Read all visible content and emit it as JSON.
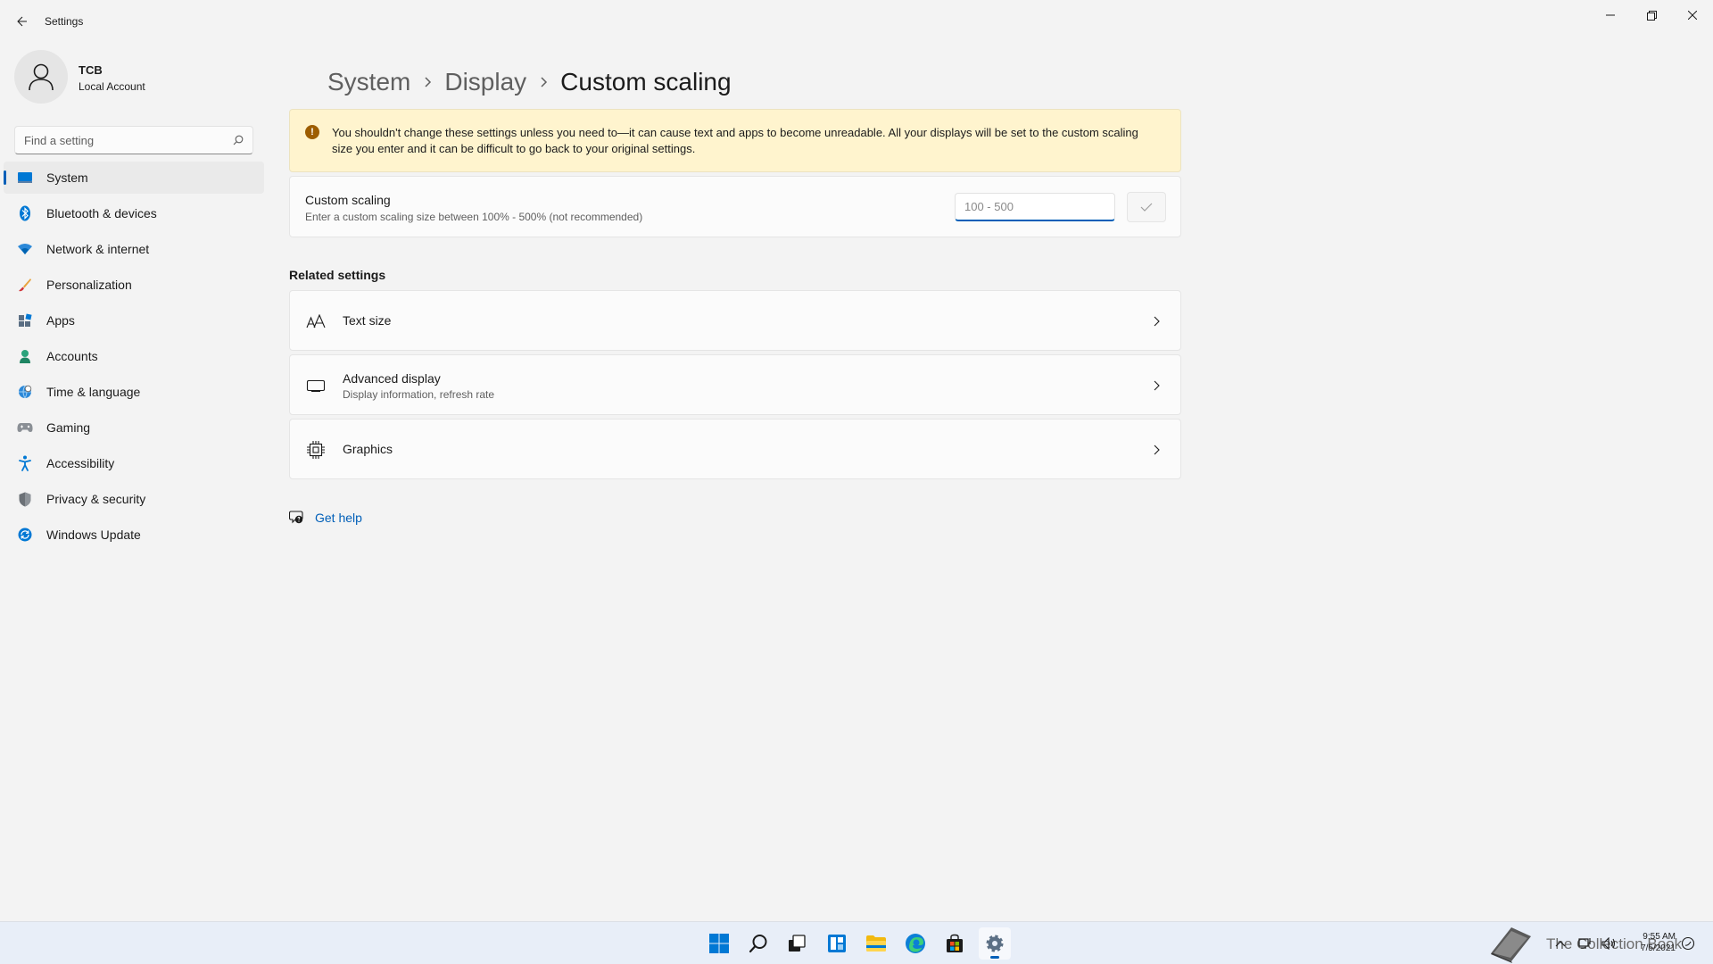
{
  "window": {
    "title": "Settings",
    "controls": [
      "minimize",
      "restore",
      "close"
    ]
  },
  "profile": {
    "name": "TCB",
    "account_type": "Local Account"
  },
  "search": {
    "placeholder": "Find a setting"
  },
  "sidebar": {
    "items": [
      {
        "label": "System",
        "icon": "system-icon",
        "active": true
      },
      {
        "label": "Bluetooth & devices",
        "icon": "bluetooth-icon"
      },
      {
        "label": "Network & internet",
        "icon": "network-icon"
      },
      {
        "label": "Personalization",
        "icon": "brush-icon"
      },
      {
        "label": "Apps",
        "icon": "apps-icon"
      },
      {
        "label": "Accounts",
        "icon": "accounts-icon"
      },
      {
        "label": "Time & language",
        "icon": "globe-clock-icon"
      },
      {
        "label": "Gaming",
        "icon": "controller-icon"
      },
      {
        "label": "Accessibility",
        "icon": "accessibility-icon"
      },
      {
        "label": "Privacy & security",
        "icon": "shield-icon"
      },
      {
        "label": "Windows Update",
        "icon": "update-icon"
      }
    ]
  },
  "breadcrumb": [
    "System",
    "Display",
    "Custom scaling"
  ],
  "warning": {
    "text": "You shouldn't change these settings unless you need to—it can cause text and apps to become unreadable. All your displays will be set to the custom scaling size you enter and it can be difficult to go back to your original settings."
  },
  "custom_scaling": {
    "title": "Custom scaling",
    "description": "Enter a custom scaling size between 100% - 500% (not recommended)",
    "input_placeholder": "100 - 500",
    "input_value": ""
  },
  "related": {
    "heading": "Related settings",
    "items": [
      {
        "title": "Text size",
        "subtitle": "",
        "icon": "text-size-icon"
      },
      {
        "title": "Advanced display",
        "subtitle": "Display information, refresh rate",
        "icon": "monitor-icon"
      },
      {
        "title": "Graphics",
        "subtitle": "",
        "icon": "chip-icon"
      }
    ]
  },
  "help": {
    "label": "Get help"
  },
  "taskbar": {
    "apps": [
      "start",
      "search",
      "task-view",
      "widgets",
      "file-explorer",
      "edge",
      "store",
      "settings"
    ],
    "active_app": "settings",
    "clock_time": "9:55 AM",
    "clock_date": "7/5/2021",
    "watermark": "The Collection Book"
  },
  "colors": {
    "accent": "#005fb8",
    "warning_bg": "#fff4ce",
    "warning_icon": "#9d5d00",
    "window_bg": "#f3f3f3",
    "card_bg": "#fbfbfb"
  }
}
